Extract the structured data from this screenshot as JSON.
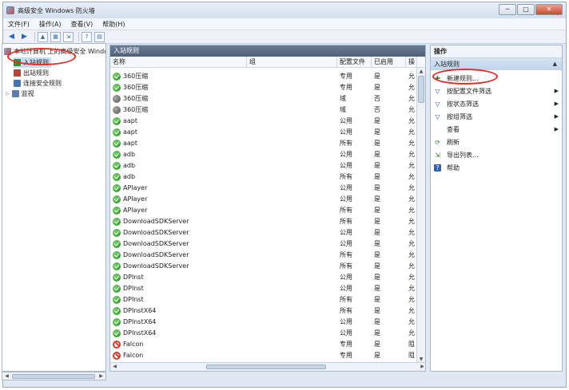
{
  "window": {
    "title": "高级安全 Windows 防火墙",
    "controls": [
      "─",
      "□",
      "✕"
    ]
  },
  "menu": [
    "文件(F)",
    "操作(A)",
    "查看(V)",
    "帮助(H)"
  ],
  "toolbar_icons": [
    "back-arrow-icon",
    "forward-arrow-icon",
    "folder-up-icon",
    "console-tree-icon",
    "export-icon",
    "help-icon",
    "properties-icon"
  ],
  "tree": {
    "root": "本地计算机 上的高级安全 Windows 防火墙",
    "items": [
      "入站规则",
      "出站规则",
      "连接安全规则",
      "监视"
    ]
  },
  "center": {
    "header": "入站规则",
    "columns": [
      "名称",
      "组",
      "配置文件",
      "已启用",
      "操"
    ],
    "rows": [
      {
        "status": "allow",
        "name": "360压缩",
        "group": "",
        "profile": "专用",
        "enabled": "是",
        "action": "允"
      },
      {
        "status": "allow",
        "name": "360压缩",
        "group": "",
        "profile": "专用",
        "enabled": "是",
        "action": "允"
      },
      {
        "status": "disabled",
        "name": "360压缩",
        "group": "",
        "profile": "域",
        "enabled": "否",
        "action": "允"
      },
      {
        "status": "disabled",
        "name": "360压缩",
        "group": "",
        "profile": "域",
        "enabled": "否",
        "action": "允"
      },
      {
        "status": "allow",
        "name": "aapt",
        "group": "",
        "profile": "公用",
        "enabled": "是",
        "action": "允"
      },
      {
        "status": "allow",
        "name": "aapt",
        "group": "",
        "profile": "公用",
        "enabled": "是",
        "action": "允"
      },
      {
        "status": "allow",
        "name": "aapt",
        "group": "",
        "profile": "所有",
        "enabled": "是",
        "action": "允"
      },
      {
        "status": "allow",
        "name": "adb",
        "group": "",
        "profile": "公用",
        "enabled": "是",
        "action": "允"
      },
      {
        "status": "allow",
        "name": "adb",
        "group": "",
        "profile": "公用",
        "enabled": "是",
        "action": "允"
      },
      {
        "status": "allow",
        "name": "adb",
        "group": "",
        "profile": "所有",
        "enabled": "是",
        "action": "允"
      },
      {
        "status": "allow",
        "name": "APlayer",
        "group": "",
        "profile": "公用",
        "enabled": "是",
        "action": "允"
      },
      {
        "status": "allow",
        "name": "APlayer",
        "group": "",
        "profile": "公用",
        "enabled": "是",
        "action": "允"
      },
      {
        "status": "allow",
        "name": "APlayer",
        "group": "",
        "profile": "所有",
        "enabled": "是",
        "action": "允"
      },
      {
        "status": "allow",
        "name": "DownloadSDKServer",
        "group": "",
        "profile": "所有",
        "enabled": "是",
        "action": "允"
      },
      {
        "status": "allow",
        "name": "DownloadSDKServer",
        "group": "",
        "profile": "公用",
        "enabled": "是",
        "action": "允"
      },
      {
        "status": "allow",
        "name": "DownloadSDKServer",
        "group": "",
        "profile": "公用",
        "enabled": "是",
        "action": "允"
      },
      {
        "status": "allow",
        "name": "DownloadSDKServer",
        "group": "",
        "profile": "所有",
        "enabled": "是",
        "action": "允"
      },
      {
        "status": "allow",
        "name": "DownloadSDKServer",
        "group": "",
        "profile": "所有",
        "enabled": "是",
        "action": "允"
      },
      {
        "status": "allow",
        "name": "DPInst",
        "group": "",
        "profile": "公用",
        "enabled": "是",
        "action": "允"
      },
      {
        "status": "allow",
        "name": "DPInst",
        "group": "",
        "profile": "公用",
        "enabled": "是",
        "action": "允"
      },
      {
        "status": "allow",
        "name": "DPInst",
        "group": "",
        "profile": "所有",
        "enabled": "是",
        "action": "允"
      },
      {
        "status": "allow",
        "name": "DPInstX64",
        "group": "",
        "profile": "所有",
        "enabled": "是",
        "action": "允"
      },
      {
        "status": "allow",
        "name": "DPInstX64",
        "group": "",
        "profile": "公用",
        "enabled": "是",
        "action": "允"
      },
      {
        "status": "allow",
        "name": "DPInstX64",
        "group": "",
        "profile": "公用",
        "enabled": "是",
        "action": "允"
      },
      {
        "status": "block",
        "name": "Falcon",
        "group": "",
        "profile": "专用",
        "enabled": "是",
        "action": "阻"
      },
      {
        "status": "block",
        "name": "Falcon",
        "group": "",
        "profile": "专用",
        "enabled": "是",
        "action": "阻"
      }
    ]
  },
  "actions": {
    "title": "操作",
    "section": "入站规则",
    "collapse": "▲",
    "items": [
      {
        "label": "新建规则...",
        "icon": "new-rule-icon",
        "glyph": "✚",
        "arrow": false
      },
      {
        "label": "按配置文件筛选",
        "icon": "filter-icon",
        "glyph": "▽",
        "arrow": true
      },
      {
        "label": "按状态筛选",
        "icon": "filter-icon",
        "glyph": "▽",
        "arrow": true
      },
      {
        "label": "按组筛选",
        "icon": "filter-icon",
        "glyph": "▽",
        "arrow": true
      },
      {
        "label": "查看",
        "icon": "",
        "glyph": "",
        "arrow": true
      },
      {
        "label": "刷新",
        "icon": "refresh-icon",
        "glyph": "⟳",
        "arrow": false
      },
      {
        "label": "导出列表...",
        "icon": "export-list-icon",
        "glyph": "⇲",
        "arrow": false
      },
      {
        "label": "帮助",
        "icon": "help-icon",
        "glyph": "?",
        "arrow": false
      }
    ]
  },
  "colors": {
    "accent": "#4f6079",
    "selection": "#c9dcf2",
    "annotation": "#e0302a"
  }
}
